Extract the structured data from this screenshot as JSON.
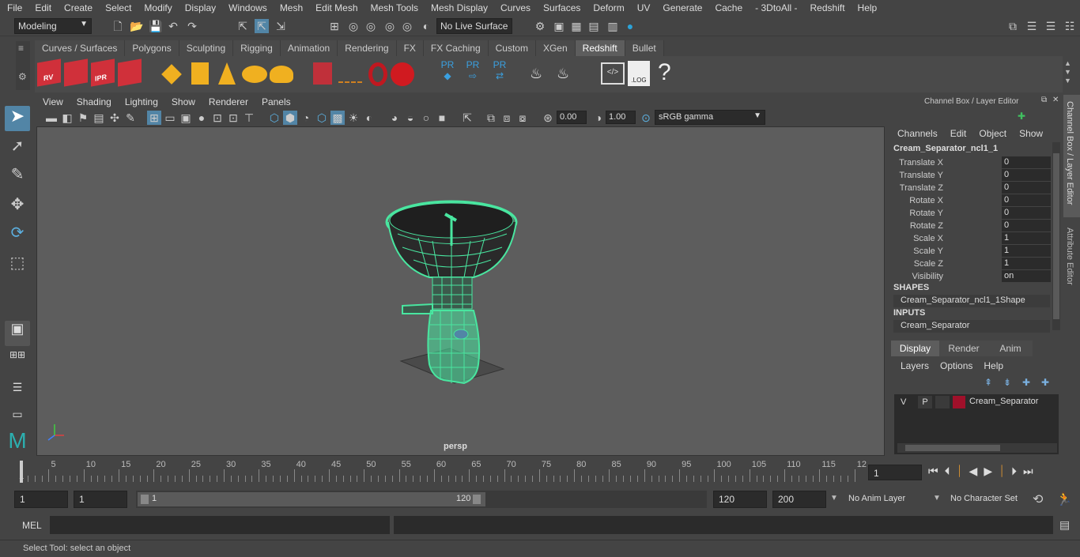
{
  "menus": [
    "File",
    "Edit",
    "Create",
    "Select",
    "Modify",
    "Display",
    "Windows",
    "Mesh",
    "Edit Mesh",
    "Mesh Tools",
    "Mesh Display",
    "Curves",
    "Surfaces",
    "Deform",
    "UV",
    "Generate",
    "Cache",
    "- 3DtoAll -",
    "Redshift",
    "Help"
  ],
  "status": {
    "mode": "Modeling",
    "live_surface": "No Live Surface"
  },
  "shelf": {
    "tabs": [
      "Curves / Surfaces",
      "Polygons",
      "Sculpting",
      "Rigging",
      "Animation",
      "Rendering",
      "FX",
      "FX Caching",
      "Custom",
      "XGen",
      "Redshift",
      "Bullet"
    ],
    "active_tab": "Redshift",
    "icon_labels": [
      "RV",
      "IPR",
      "PR",
      "PR",
      "PR",
      ".LOG",
      "?"
    ]
  },
  "viewport": {
    "menus": [
      "View",
      "Shading",
      "Lighting",
      "Show",
      "Renderer",
      "Panels"
    ],
    "exposure": "0.00",
    "gamma": "1.00",
    "color_space": "sRGB gamma",
    "camera": "persp"
  },
  "channel_box": {
    "title": "Channel Box / Layer Editor",
    "menus": [
      "Channels",
      "Edit",
      "Object",
      "Show"
    ],
    "object": "Cream_Separator_ncl1_1",
    "attrs": [
      {
        "label": "Translate X",
        "value": "0"
      },
      {
        "label": "Translate Y",
        "value": "0"
      },
      {
        "label": "Translate Z",
        "value": "0"
      },
      {
        "label": "Rotate X",
        "value": "0"
      },
      {
        "label": "Rotate Y",
        "value": "0"
      },
      {
        "label": "Rotate Z",
        "value": "0"
      },
      {
        "label": "Scale X",
        "value": "1"
      },
      {
        "label": "Scale Y",
        "value": "1"
      },
      {
        "label": "Scale Z",
        "value": "1"
      },
      {
        "label": "Visibility",
        "value": "on"
      }
    ],
    "shapes_header": "SHAPES",
    "shape": "Cream_Separator_ncl1_1Shape",
    "inputs_header": "INPUTS",
    "input": "Cream_Separator"
  },
  "side_tabs": [
    "Channel Box / Layer Editor",
    "Attribute Editor"
  ],
  "layer_editor": {
    "tabs": [
      "Display",
      "Render",
      "Anim"
    ],
    "active_tab": "Display",
    "menus": [
      "Layers",
      "Options",
      "Help"
    ],
    "layer": {
      "v": "V",
      "p": "P",
      "name": "Cream_Separator",
      "color": "#a0102a"
    }
  },
  "timeline": {
    "ticks": [
      "5",
      "10",
      "15",
      "20",
      "25",
      "30",
      "35",
      "40",
      "45",
      "50",
      "55",
      "60",
      "65",
      "70",
      "75",
      "80",
      "85",
      "90",
      "95",
      "100",
      "105",
      "110",
      "115",
      "12"
    ],
    "start_label": "1",
    "current_frame": "1"
  },
  "range": {
    "start": "1",
    "playback_start": "1",
    "slider_start": "1",
    "slider_end": "120",
    "playback_end": "120",
    "end": "200",
    "anim_layer": "No Anim Layer",
    "char_set": "No Character Set"
  },
  "command": {
    "lang": "MEL"
  },
  "help_line": "Select Tool: select an object",
  "colors": {
    "wire": "#49e6a0",
    "accent": "#5285a6"
  }
}
